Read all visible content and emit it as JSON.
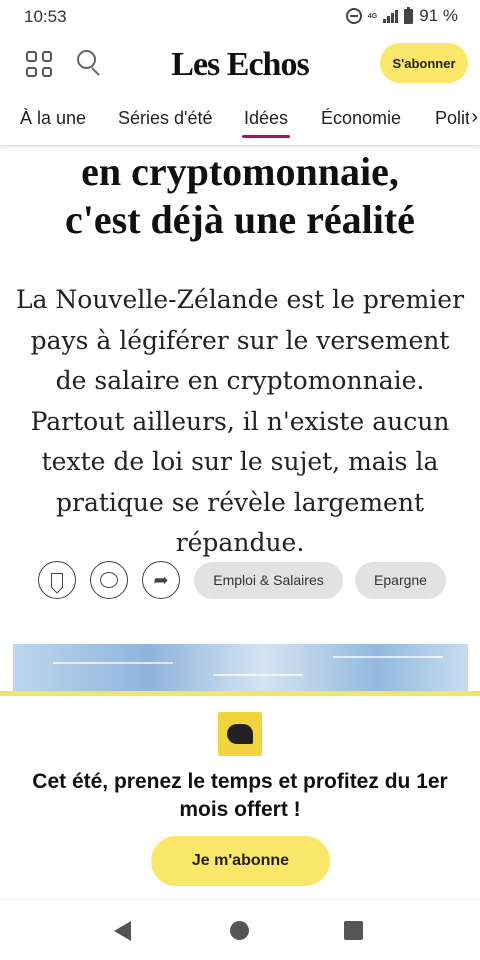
{
  "status": {
    "time": "10:53",
    "network": "4G",
    "battery": "91 %"
  },
  "header": {
    "logo": "Les Echos",
    "subscribe_label": "S'abonner"
  },
  "nav": {
    "items": [
      "À la une",
      "Séries d'été",
      "Idées",
      "Économie",
      "Polit"
    ],
    "active": "Idées"
  },
  "article": {
    "title_lines": [
      "en cryptomonnaie,",
      "c'est déjà une réalité"
    ],
    "lead": "La Nouvelle-Zélande est le premier pays à légiférer sur le versement de salaire en cryptomonnaie. Partout ailleurs, il n'existe aucun texte de loi sur le sujet, mais la pratique se révèle largement répandue.",
    "tags": [
      "Emploi & Salaires",
      "Epargne"
    ]
  },
  "promo": {
    "text": "Cet été, prenez le temps et profitez du 1er mois offert !",
    "button_label": "Je m'abonne"
  },
  "colors": {
    "accent_yellow": "#fbe86a",
    "active_tab_underline": "#a0175b",
    "tag_bg": "#e2e2e2"
  },
  "icons": [
    "dnd-icon",
    "signal-icon",
    "battery-icon",
    "menu-grid-icon",
    "search-icon",
    "bookmark-icon",
    "comment-icon",
    "share-icon",
    "back-icon",
    "home-icon",
    "recent-apps-icon"
  ]
}
